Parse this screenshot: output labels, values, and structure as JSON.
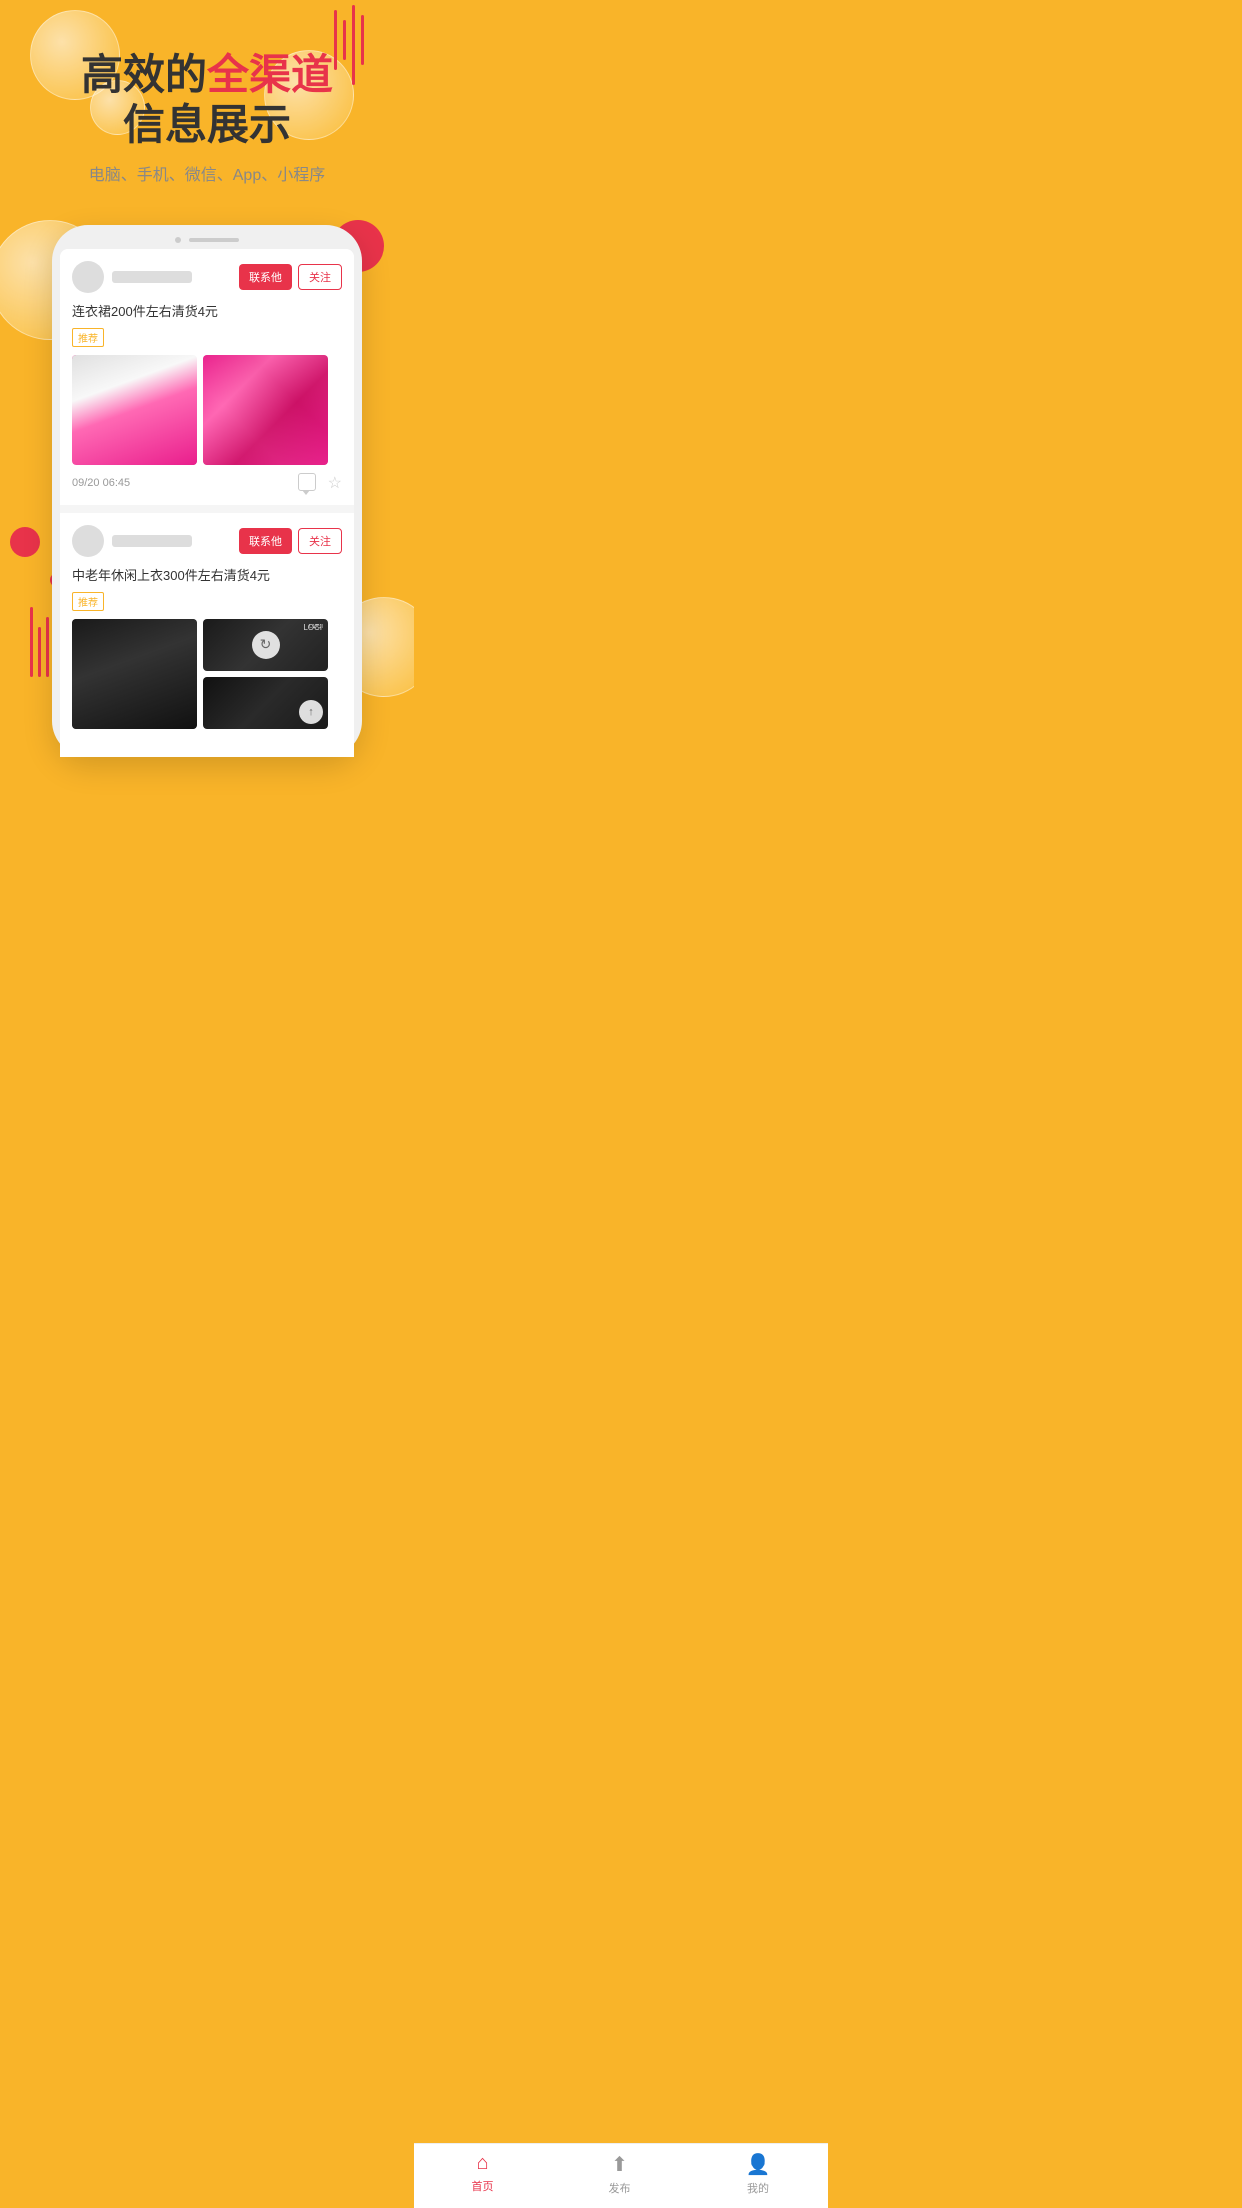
{
  "background": {
    "color": "#F9B429"
  },
  "hero": {
    "title_line1": "高效的",
    "title_highlight": "全渠道",
    "title_line2": "信息展示",
    "subtitle": "电脑、手机、微信、App、小程序"
  },
  "post1": {
    "title": "连衣裙200件左右清货4元",
    "tag": "推荐",
    "time": "09/20 06:45",
    "btn_contact": "联系他",
    "btn_follow": "关注"
  },
  "post2": {
    "title": "中老年休闲上衣300件左右清货4元",
    "tag": "推荐",
    "btn_contact": "联系他",
    "btn_follow": "关注"
  },
  "nav": {
    "home_label": "首页",
    "publish_label": "发布",
    "mine_label": "我的"
  }
}
